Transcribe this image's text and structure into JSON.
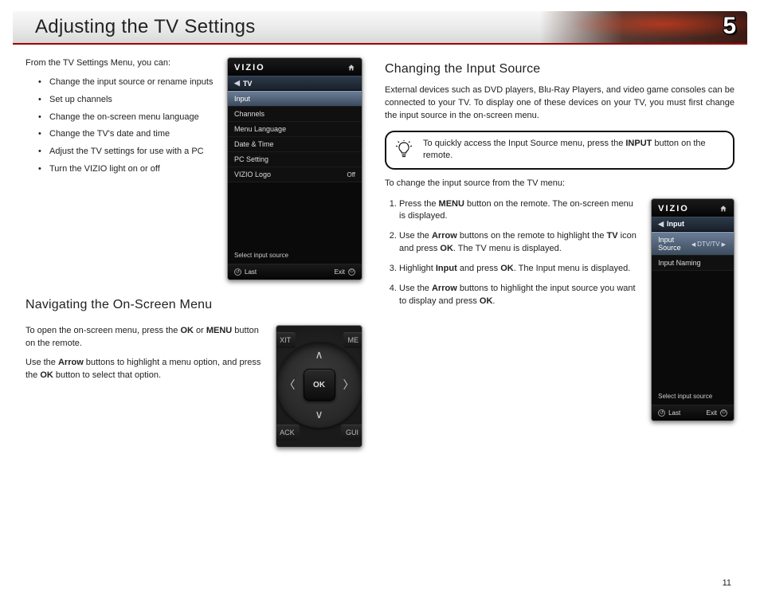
{
  "banner": {
    "title": "Adjusting the TV Settings",
    "chapter_number": "5"
  },
  "page_number": "11",
  "left": {
    "intro_lead": "From the TV Settings Menu, you can:",
    "bullets": [
      "Change the input source or rename inputs",
      "Set up channels",
      "Change the on-screen menu language",
      "Change the TV's date and time",
      "Adjust the TV settings for use with a PC",
      "Turn the VIZIO light on or off"
    ],
    "nav_heading": "Navigating the On-Screen Menu",
    "nav_p1_pre": "To open the on-screen menu, press the ",
    "nav_p1_b1": "OK",
    "nav_p1_mid": " or ",
    "nav_p1_b2": "MENU",
    "nav_p1_post": " button on the remote.",
    "nav_p2_pre": "Use the ",
    "nav_p2_b1": "Arrow",
    "nav_p2_mid": " buttons to highlight a menu option, and press the ",
    "nav_p2_b2": "OK",
    "nav_p2_post": " button to select that option."
  },
  "right": {
    "heading": "Changing the Input Source",
    "p1": "External devices such as DVD players, Blu-Ray Players, and video game consoles can be connected to your TV. To display one of these devices on your TV, you must first change the input source in the on-screen menu.",
    "tip_pre": "To quickly access the Input Source menu, press the ",
    "tip_b": "INPUT",
    "tip_post": " button on the remote.",
    "lead": "To change the input source from the TV menu:",
    "steps": [
      {
        "pre": "Press the ",
        "b": "MENU",
        "post": " button on the remote. The on-screen menu is displayed."
      },
      {
        "pre": "Use the ",
        "b": "Arrow",
        "mid": " buttons on the remote to highlight the ",
        "b2": "TV",
        "mid2": " icon and press ",
        "b3": "OK",
        "post": ". The TV menu is displayed."
      },
      {
        "pre": "Highlight ",
        "b": "Input",
        "mid": " and press ",
        "b2": "OK",
        "post": ". The Input menu is displayed."
      },
      {
        "pre": "Use the ",
        "b": "Arrow",
        "mid": " buttons to highlight the input source you want to display and press ",
        "b2": "OK",
        "post": "."
      }
    ]
  },
  "tv1": {
    "brand": "VIZIO",
    "crumb": "TV",
    "rows": [
      {
        "label": "Input",
        "value": "",
        "selected": true
      },
      {
        "label": "Channels",
        "value": ""
      },
      {
        "label": "Menu Language",
        "value": ""
      },
      {
        "label": "Date & Time",
        "value": ""
      },
      {
        "label": "PC Setting",
        "value": ""
      },
      {
        "label": "VIZIO Logo",
        "value": "Off"
      }
    ],
    "hint": "Select input source",
    "foot_left": "Last",
    "foot_right": "Exit"
  },
  "tv2": {
    "brand": "VIZIO",
    "crumb": "Input",
    "rows": [
      {
        "label": "Input Source",
        "value": "DTV/TV",
        "selected": true,
        "lr": true
      },
      {
        "label": "Input Naming",
        "value": ""
      }
    ],
    "hint": "Select input source",
    "foot_left": "Last",
    "foot_right": "Exit"
  },
  "remote": {
    "ok": "OK",
    "tl": "XIT",
    "tr": "ME",
    "bl": "ACK",
    "br": "GUI"
  }
}
